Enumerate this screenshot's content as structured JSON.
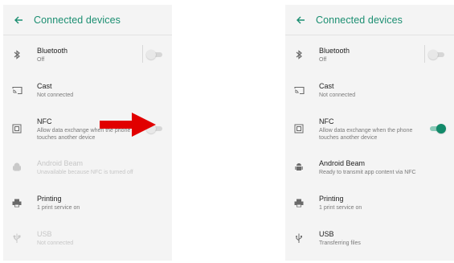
{
  "colors": {
    "accent": "#1b8e71",
    "toggle_on": "#128a6a",
    "arrow": "#e10000"
  },
  "left": {
    "title": "Connected devices",
    "items": [
      {
        "label": "Bluetooth",
        "sub": "Off",
        "icon": "bluetooth-icon",
        "toggle": "off"
      },
      {
        "label": "Cast",
        "sub": "Not connected",
        "icon": "cast-icon"
      },
      {
        "label": "NFC",
        "sub": "Allow data exchange when the phone touches another device",
        "icon": "nfc-icon",
        "toggle": "off"
      },
      {
        "label": "Android Beam",
        "sub": "Unavailable because NFC is turned off",
        "icon": "android-icon",
        "disabled": true
      },
      {
        "label": "Printing",
        "sub": "1 print service on",
        "icon": "printer-icon"
      },
      {
        "label": "USB",
        "sub": "Not connected",
        "icon": "usb-icon",
        "disabled": true
      }
    ]
  },
  "right": {
    "title": "Connected devices",
    "items": [
      {
        "label": "Bluetooth",
        "sub": "Off",
        "icon": "bluetooth-icon",
        "toggle": "off"
      },
      {
        "label": "Cast",
        "sub": "Not connected",
        "icon": "cast-icon"
      },
      {
        "label": "NFC",
        "sub": "Allow data exchange when the phone touches another device",
        "icon": "nfc-icon",
        "toggle": "on"
      },
      {
        "label": "Android Beam",
        "sub": "Ready to transmit app content via NFC",
        "icon": "android-icon"
      },
      {
        "label": "Printing",
        "sub": "1 print service on",
        "icon": "printer-icon"
      },
      {
        "label": "USB",
        "sub": "Transferring files",
        "icon": "usb-icon"
      }
    ]
  }
}
